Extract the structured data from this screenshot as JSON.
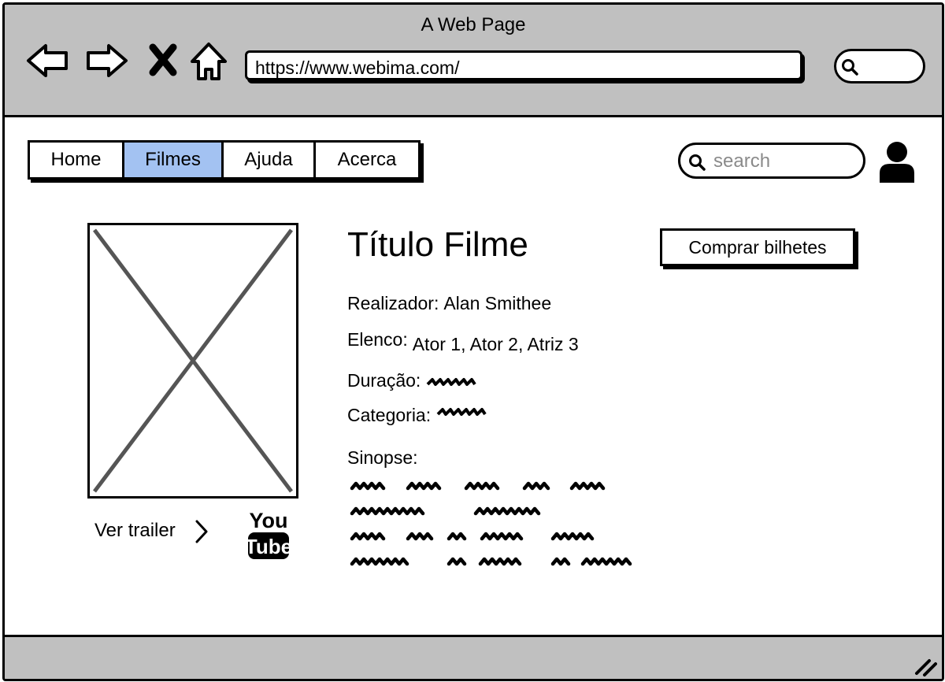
{
  "window": {
    "title": "A Web Page",
    "url": "https://www.webima.com/"
  },
  "nav": {
    "tabs": [
      {
        "label": "Home",
        "active": false
      },
      {
        "label": "Filmes",
        "active": true
      },
      {
        "label": "Ajuda",
        "active": false
      },
      {
        "label": "Acerca",
        "active": false
      }
    ],
    "active_color": "#a3c2f2"
  },
  "search": {
    "placeholder": "search"
  },
  "movie": {
    "title": "Título Filme",
    "buy_button": "Comprar bilhetes",
    "director_label": "Realizador:",
    "director": "Alan Smithee",
    "cast_label": "Elenco:",
    "cast": "Ator 1, Ator 2, Atriz 3",
    "duration_label": "Duração:",
    "category_label": "Categoria:",
    "synopsis_label": "Sinopse:",
    "trailer_label": "Ver trailer"
  },
  "icons": {
    "back": "back-arrow-icon",
    "forward": "forward-arrow-icon",
    "close": "close-icon",
    "home": "home-icon",
    "search": "search-icon",
    "user": "user-icon",
    "youtube": "youtube-logo",
    "chevron": "chevron-right-icon"
  },
  "colors": {
    "chrome": "#c0c0c0",
    "active_tab": "#a3c2f2"
  }
}
